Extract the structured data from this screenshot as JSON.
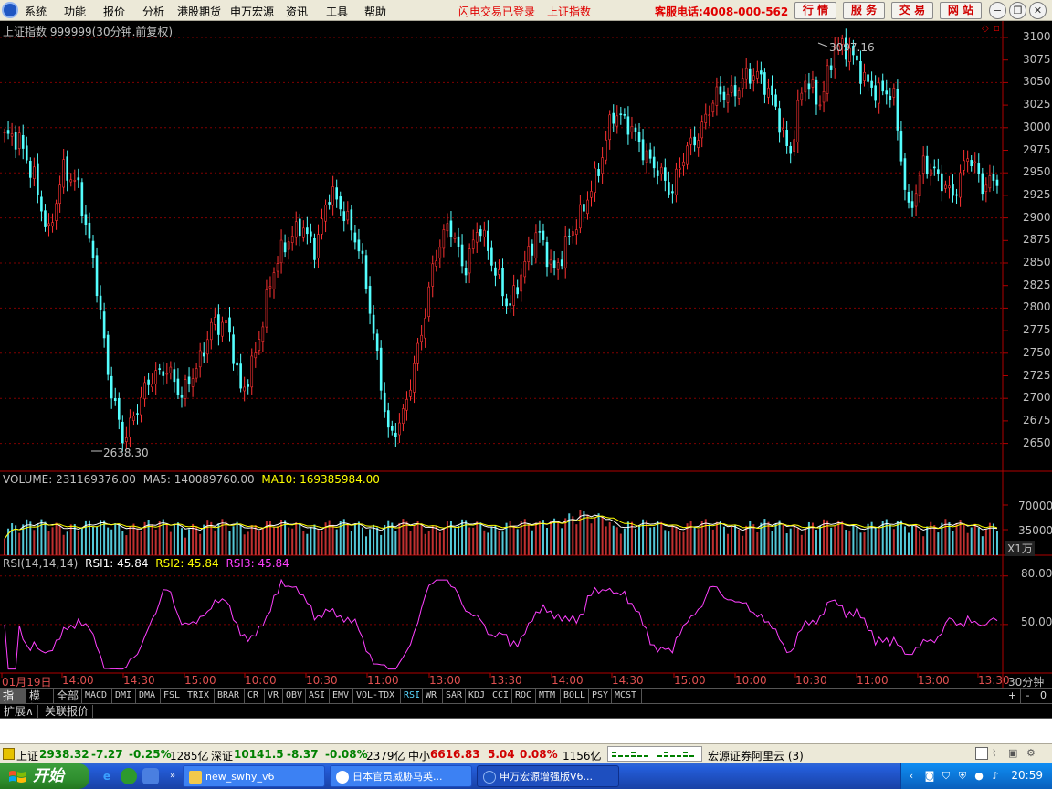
{
  "menu": {
    "items": [
      "系统",
      "功能",
      "报价",
      "分析",
      "港股期货",
      "申万宏源",
      "资讯",
      "工具",
      "帮助"
    ],
    "flash_login": "闪电交易已登录",
    "index_name": "上证指数",
    "service_phone": "客服电话:4008-000-562",
    "buttons": [
      "行 情",
      "服 务",
      "交 易",
      "网 站"
    ]
  },
  "chart": {
    "title": "上证指数 999999(30分钟.前复权)",
    "high_label": "3097.16",
    "low_label": "2638.30",
    "price_axis": [
      "3100",
      "3075",
      "3050",
      "3025",
      "3000",
      "2975",
      "2950",
      "2925",
      "2900",
      "2875",
      "2850",
      "2825",
      "2800",
      "2775",
      "2750",
      "2725",
      "2700",
      "2675",
      "2650"
    ],
    "volume_legend": {
      "volume": "VOLUME: 231169376.00",
      "ma5": "MA5: 140089760.00",
      "ma10": "MA10: 169385984.00"
    },
    "volume_axis": [
      "70000",
      "35000"
    ],
    "volume_unit": "X1万",
    "rsi_legend": {
      "name": "RSI(14,14,14)",
      "rsi1": "RSI1: 45.84",
      "rsi2": "RSI2: 45.84",
      "rsi3": "RSI3: 45.84"
    },
    "rsi_axis": [
      "80.00",
      "50.00"
    ],
    "time_axis": [
      "01月19日",
      "14:00",
      "14:30",
      "15:00",
      "10:00",
      "10:30",
      "11:00",
      "13:00",
      "13:30",
      "14:00",
      "14:30",
      "15:00",
      "10:00",
      "10:30",
      "11:00",
      "13:00",
      "13:30"
    ],
    "period": "30分钟"
  },
  "chart_data": {
    "type": "candlestick",
    "title": "上证指数 999999(30分钟.前复权)",
    "ylim": [
      2630,
      3110
    ],
    "max": 3097.16,
    "min": 2638.3,
    "approx_close_path": [
      2990,
      2980,
      2950,
      2880,
      2950,
      2940,
      2850,
      2720,
      2660,
      2690,
      2720,
      2740,
      2700,
      2730,
      2790,
      2780,
      2700,
      2760,
      2830,
      2870,
      2900,
      2860,
      2930,
      2910,
      2860,
      2760,
      2660,
      2680,
      2760,
      2860,
      2890,
      2840,
      2900,
      2840,
      2800,
      2850,
      2880,
      2840,
      2880,
      2900,
      2950,
      3020,
      3000,
      2980,
      2960,
      2920,
      2980,
      3000,
      3030,
      3040,
      3060,
      3050,
      3030,
      2970,
      3050,
      3030,
      3090,
      3080,
      3060,
      3040,
      3030,
      2910,
      2960,
      2940,
      2930,
      2970,
      2930,
      2950
    ],
    "rsi": {
      "period": "14,14,14",
      "rsi1": 45.84,
      "rsi2": 45.84,
      "rsi3": 45.84,
      "ylim": [
        20,
        90
      ]
    },
    "volume": {
      "volume": 231169376.0,
      "ma5": 140089760.0,
      "ma10": 169385984.0,
      "unit": "X1万"
    }
  },
  "indicator_tabs": [
    "指标",
    "模板",
    "全部",
    "MACD",
    "DMI",
    "DMA",
    "FSL",
    "TRIX",
    "BRAR",
    "CR",
    "VR",
    "OBV",
    "ASI",
    "EMV",
    "VOL-TDX",
    "RSI",
    "WR",
    "SAR",
    "KDJ",
    "CCI",
    "ROC",
    "MTM",
    "BOLL",
    "PSY",
    "MCST"
  ],
  "indicator_buttons": [
    "+",
    "-",
    "0"
  ],
  "sub_tabs": [
    "扩展∧",
    "关联报价"
  ],
  "status": {
    "sh_label": "上证",
    "sh_value": "2938.32",
    "sh_change": "-7.27",
    "sh_pct": "-0.25%",
    "sh_amount": "1285亿",
    "sz_label": "深证",
    "sz_value": "10141.5",
    "sz_change": "-8.37",
    "sz_pct": "-0.08%",
    "sz_amount": "2379亿",
    "zx_label": "中小",
    "zx_value": "6616.83",
    "zx_change": "5.04",
    "zx_pct": "0.08%",
    "zx_amount": "1156亿",
    "server": "宏源证券阿里云 (3)"
  },
  "taskbar": {
    "start": "开始",
    "tasks": [
      "new_swhy_v6",
      "日本官员威胁马英...",
      "申万宏源增强版V6..."
    ],
    "clock": "20:59"
  }
}
